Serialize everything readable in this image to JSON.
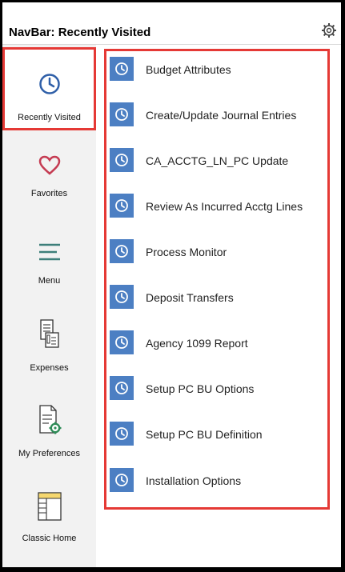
{
  "header": {
    "title": "NavBar: Recently Visited"
  },
  "sidebar": {
    "items": [
      {
        "label": "Recently Visited",
        "icon": "clock-icon",
        "active": true
      },
      {
        "label": "Favorites",
        "icon": "heart-icon",
        "active": false
      },
      {
        "label": "Menu",
        "icon": "menu-icon",
        "active": false
      },
      {
        "label": "Expenses",
        "icon": "expenses-icon",
        "active": false
      },
      {
        "label": "My Preferences",
        "icon": "preferences-icon",
        "active": false
      },
      {
        "label": "Classic Home",
        "icon": "classic-home-icon",
        "active": false
      }
    ]
  },
  "recent": {
    "items": [
      {
        "label": "Budget Attributes"
      },
      {
        "label": "Create/Update Journal Entries"
      },
      {
        "label": "CA_ACCTG_LN_PC Update"
      },
      {
        "label": "Review As Incurred Acctg Lines"
      },
      {
        "label": "Process Monitor"
      },
      {
        "label": "Deposit Transfers"
      },
      {
        "label": "Agency 1099 Report"
      },
      {
        "label": "Setup PC BU Options"
      },
      {
        "label": "Setup PC BU Definition"
      },
      {
        "label": "Installation Options"
      }
    ]
  },
  "colors": {
    "accent": "#4c7fc3",
    "highlight": "#e53935",
    "teal": "#3d7f7a",
    "heart": "#c53b52"
  }
}
